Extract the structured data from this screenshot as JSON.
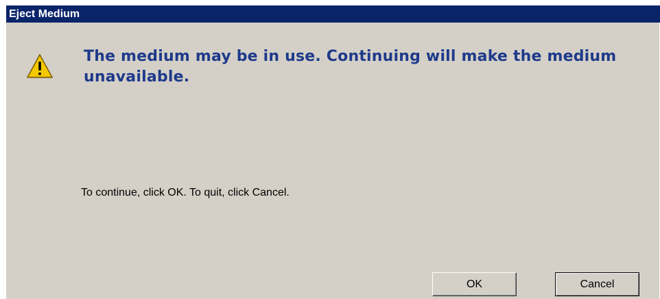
{
  "window": {
    "title": "Eject Medium"
  },
  "message": {
    "headline": "The medium may be in use. Continuing will make the medium unavailable.",
    "instruction": "To continue, click OK. To quit, click Cancel.",
    "icon": "warning-icon"
  },
  "buttons": {
    "ok_label": "OK",
    "cancel_label": "Cancel"
  },
  "colors": {
    "titlebar": "#0a246a",
    "dialog_face": "#d4d0c8",
    "headline_text": "#1e3a8a",
    "warning_yellow": "#f5c800"
  }
}
